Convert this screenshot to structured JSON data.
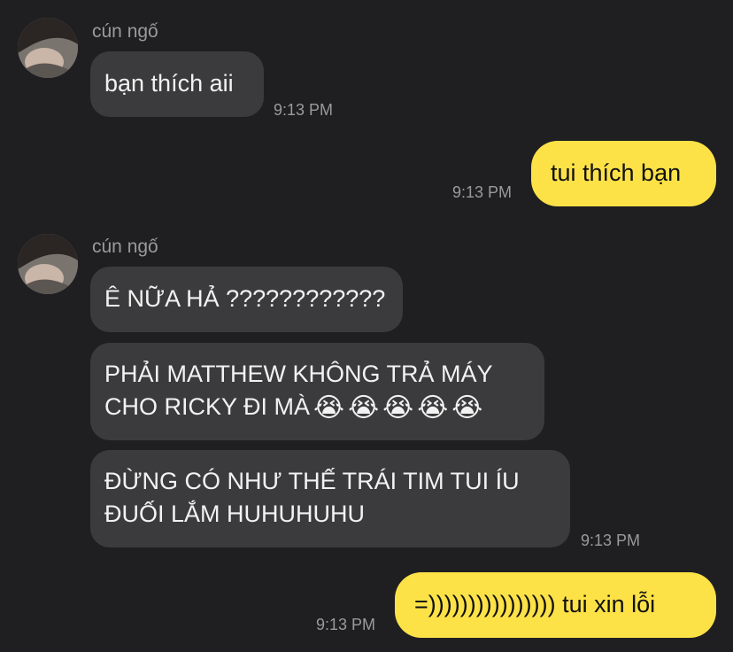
{
  "contact": {
    "name": "cún ngố"
  },
  "messages": [
    {
      "sender": "cún ngố",
      "text": "bạn thích aii",
      "time": "9:13 PM"
    },
    {
      "text": "tui thích bạn",
      "time": "9:13 PM"
    },
    {
      "sender": "cún ngố",
      "text": "Ê NỮA HẢ ????????????"
    },
    {
      "line1": "PHẢI MATTHEW KHÔNG TRẢ MÁY",
      "line2": "CHO RICKY ĐI MÀ",
      "emoji": "😭",
      "emoji_icon": "loudly-crying-face-icon"
    },
    {
      "line1": "ĐỪNG CÓ NHƯ THẾ TRÁI TIM TUI ÍU",
      "line2": "ĐUỐI LẮM HUHUHUHU",
      "time": "9:13 PM"
    },
    {
      "text": "=)))))))))))))))) tui xin lỗi",
      "time": "9:13 PM"
    }
  ],
  "colors": {
    "background": "#1f1f21",
    "incoming_bubble": "#3b3b3d",
    "outgoing_bubble": "#fde247",
    "meta_text": "#9a9a9c"
  }
}
